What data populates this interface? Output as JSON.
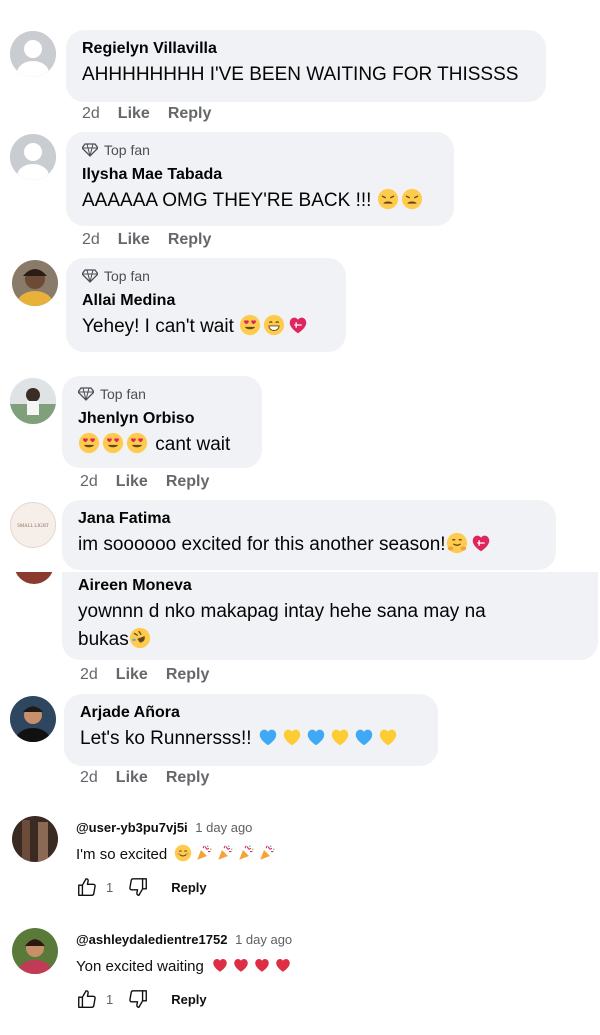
{
  "labels": {
    "like": "Like",
    "reply": "Reply",
    "top_fan": "Top fan"
  },
  "fb_comments": [
    {
      "author": "Regielyn Villavilla",
      "text": "AHHHHHHHH I'VE BEEN WAITING FOR THISSSS",
      "time": "2d"
    },
    {
      "author": "Ilysha Mae Tabada",
      "text": "AAAAAA OMG THEY'RE BACK !!!",
      "time": "2d",
      "top_fan": true
    },
    {
      "author": "Allai Medina",
      "text": "Yehey! I can't wait",
      "time": "",
      "top_fan": true
    },
    {
      "author": "Jhenlyn Orbiso",
      "text": "cant wait",
      "time": "2d",
      "top_fan": true
    },
    {
      "author": "Jana Fatima",
      "text": "im soooooo excited for this another season!",
      "time": ""
    },
    {
      "author": "Aireen Moneva",
      "text_line1": "yownnn d nko makapag intay hehe sana may na",
      "text_line2": "bukas",
      "time": "2d"
    },
    {
      "author": "Arjade Añora",
      "text": "Let's ko Runnersss!!",
      "time": "2d"
    }
  ],
  "yt_comments": [
    {
      "user": "@user-yb3pu7vj5i",
      "time": "1 day ago",
      "text": "I'm so excited",
      "likes": "1",
      "reply": "Reply"
    },
    {
      "user": "@ashleydaledientre1752",
      "time": "1 day ago",
      "text": "Yon excited waiting",
      "likes": "1",
      "reply": "Reply"
    }
  ],
  "colors": {
    "bubble": "#f0f2f5",
    "meta": "#65676b",
    "heart_red": "#e0245e",
    "heart_blue": "#3fa9f5",
    "heart_yellow": "#ffcc33"
  }
}
